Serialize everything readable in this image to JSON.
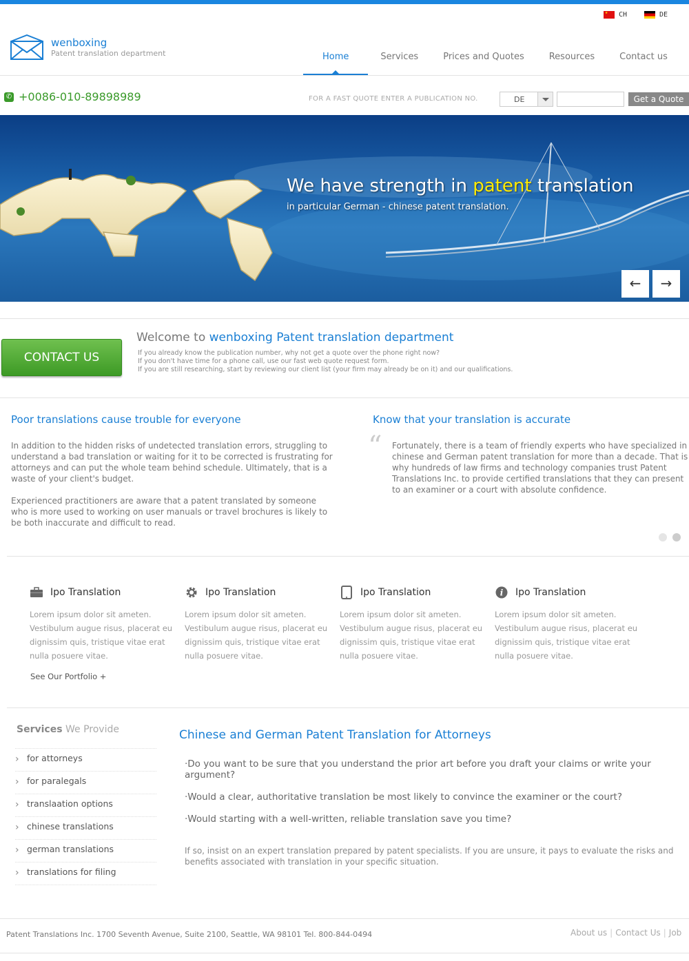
{
  "header": {
    "languages": [
      {
        "code": "CH",
        "flag": "china-flag-icon"
      },
      {
        "code": "DE",
        "flag": "germany-flag-icon"
      }
    ],
    "logo": {
      "name": "wenboxing",
      "subtitle": "Patent translation department"
    },
    "nav": [
      {
        "label": "Home",
        "active": true
      },
      {
        "label": "Services",
        "active": false
      },
      {
        "label": "Prices and Quotes",
        "active": false
      },
      {
        "label": "Resources",
        "active": false
      },
      {
        "label": "Contact us",
        "active": false
      }
    ]
  },
  "quote_bar": {
    "phone": "+0086-010-89898989",
    "label": "FOR A FAST QUOTE ENTER A PUBLICATION NO.",
    "select_value": "DE",
    "input_value": "",
    "button": "Get a Quote"
  },
  "hero": {
    "title_before": "We have strength in ",
    "title_highlight": "patent",
    "title_after": " translation",
    "subtitle": "in particular German - chinese patent translation.",
    "prev": "←",
    "next": "→"
  },
  "welcome": {
    "contact_button": "CONTACT US",
    "title_prefix": "Welcome to ",
    "title_brand": "wenboxing Patent translation department",
    "lines": [
      "If you already know the publication number, why not get a quote over the phone right now?",
      "If you don't have time for a phone call, use our fast web quote request form.",
      "If you are still researching, start by reviewing our client list (your firm may already be on it) and our qualifications."
    ]
  },
  "columns": {
    "left": {
      "title": "Poor translations cause trouble for everyone",
      "p1": "In addition to the hidden risks of undetected translation errors, struggling to understand a bad translation or waiting for it to be corrected is frustrating for attorneys and can put the whole team behind schedule. Ultimately, that is a waste of your client's budget.",
      "p2": "Experienced practitioners are aware that a patent translated by someone who is more used to working on user manuals or travel brochures is likely to be both inaccurate and difficult to read."
    },
    "right": {
      "title": "Know that your translation is accurate",
      "quote_mark": "“",
      "p1": "Fortunately, there is a team of friendly experts who have specialized in chinese and German patent translation for more than a decade. That is why hundreds of law firms and technology companies trust Patent Translations Inc. to provide certified translations that they can present to an examiner or a court with absolute confidence."
    }
  },
  "features": [
    {
      "icon": "briefcase-icon",
      "title": "Ipo Translation",
      "text": "Lorem ipsum dolor sit ameten. Vestibulum augue risus, placerat eu dignissim quis, tristique vitae erat nulla posuere vitae."
    },
    {
      "icon": "gear-icon",
      "title": "Ipo Translation",
      "text": "Lorem ipsum dolor sit ameten. Vestibulum augue risus, placerat eu dignissim quis, tristique vitae erat nulla posuere vitae."
    },
    {
      "icon": "tablet-icon",
      "title": "Ipo Translation",
      "text": "Lorem ipsum dolor sit ameten. Vestibulum augue risus, placerat eu dignissim quis, tristique vitae erat nulla posuere vitae."
    },
    {
      "icon": "info-icon",
      "title": "Ipo Translation",
      "text": "Lorem ipsum dolor sit ameten. Vestibulum augue risus, placerat eu dignissim quis, tristique vitae erat nulla posuere vitae."
    }
  ],
  "portfolio_link": "See Our Portfolio +",
  "services": {
    "head_bold": "Services",
    "head_light": " We Provide",
    "items": [
      "for attorneys",
      "for paralegals",
      "translaation options",
      "chinese translations",
      "german translations",
      "translations for filing"
    ]
  },
  "article": {
    "title": "Chinese and German Patent Translation for Attorneys",
    "questions": [
      "·Do you want to be sure that you understand the prior art before you draft your claims or write your argument?",
      "·Would a clear, authoritative translation be most likely to convince the examiner or the court?",
      "·Would starting with a well-written, reliable translation save you time?"
    ],
    "paragraph": "If so, insist on an expert translation prepared by patent specialists. If you are unsure, it pays to evaluate the risks and benefits associated with translation in your specific situation."
  },
  "footer": {
    "address": "Patent Translations Inc. 1700 Seventh Avenue, Suite 2100, Seattle, WA 98101 Tel. 800-844-0494",
    "links": [
      "About us",
      "Contact Us",
      "Job"
    ]
  },
  "colors": {
    "accent": "#1a86e0",
    "link_blue": "#1a7fd4",
    "phone_green": "#3a9a2a",
    "contact_green": "#4aa52f",
    "highlight": "#ffea00"
  }
}
